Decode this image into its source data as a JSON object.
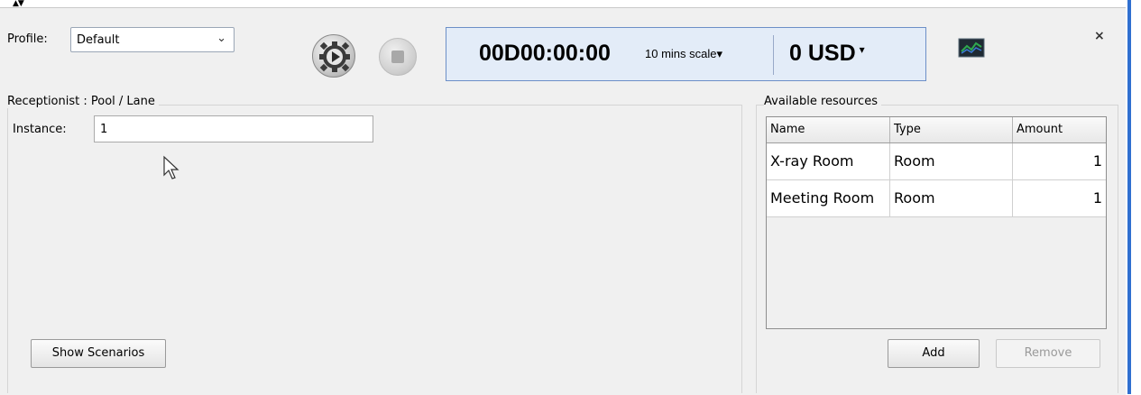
{
  "top": {
    "collapse_arrows": "▲▼"
  },
  "header": {
    "profile_label": "Profile:",
    "profile_value": "Default",
    "timer": "00D00:00:00",
    "scale": "10 mins scale",
    "scale_dropdown": "▾",
    "cost": "0  USD",
    "cost_dropdown": "▾",
    "close": "×"
  },
  "left_group": {
    "title": "Receptionist : Pool / Lane",
    "instance_label": "Instance:",
    "instance_value": "1",
    "show_scenarios": "Show Scenarios"
  },
  "right_group": {
    "title": "Available resources",
    "columns": [
      "Name",
      "Type",
      "Amount"
    ],
    "rows": [
      {
        "name": "X-ray Room",
        "type": "Room",
        "amount": "1"
      },
      {
        "name": "Meeting Room",
        "type": "Room",
        "amount": "1"
      }
    ],
    "add": "Add",
    "remove": "Remove"
  },
  "colors": {
    "accent_blue": "#2f6fd0",
    "timer_bg": "#e3ecf8",
    "chart_icon_green": "#2fa84f"
  }
}
